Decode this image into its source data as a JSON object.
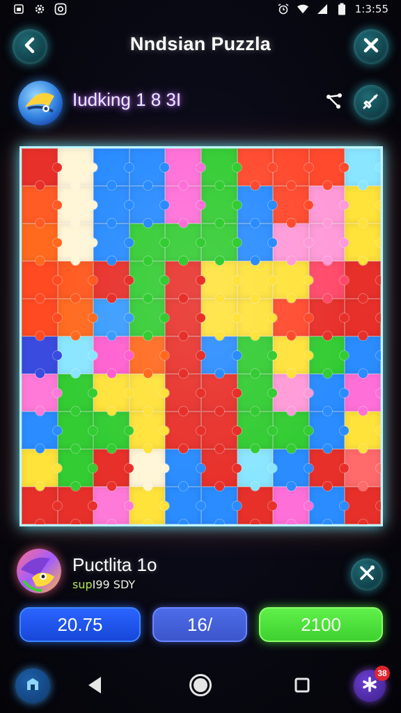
{
  "status_bar": {
    "time": "1:3:55",
    "left_icons": [
      "sim-icon",
      "settings-gear-icon",
      "at-icon"
    ],
    "right_icons": [
      "alarm-icon",
      "wifi-icon",
      "signal-icon",
      "battery-icon"
    ]
  },
  "header": {
    "title": "Nndsian Puzzla",
    "back_icon": "chevron-left-icon",
    "close_icon": "close-icon"
  },
  "player_top": {
    "name": "Iudking 1 8 3I",
    "share_icon": "share-icon",
    "hint_icon": "rocket-icon"
  },
  "board": {
    "rows": 10,
    "cols": 10,
    "pieces": [
      "#e8302a",
      "#fff6d8",
      "#2a8cff",
      "#2a8cff",
      "#ff6fd8",
      "#33cc33",
      "#ff4a2e",
      "#ff4a2e",
      "#ff4a2e",
      "#8ae6ff",
      "#ff5b25",
      "#fff6d8",
      "#2a8cff",
      "#2a8cff",
      "#ff6fd8",
      "#33cc33",
      "#2a8cff",
      "#ff4a2e",
      "#ff9ad8",
      "#ffe23a",
      "#ff6a1f",
      "#fff6d8",
      "#2a8cff",
      "#33cc33",
      "#33cc33",
      "#33cc33",
      "#2a8cff",
      "#ff9ad8",
      "#ff9ad8",
      "#ffe23a",
      "#ff4a22",
      "#ff5a20",
      "#e8302a",
      "#33cc33",
      "#e8302a",
      "#ffe23a",
      "#ffe23a",
      "#ffe23a",
      "#ff4a6a",
      "#e8302a",
      "#ff4a22",
      "#ff6a1f",
      "#3a9cff",
      "#33cc33",
      "#e8302a",
      "#ffe23a",
      "#ffe23a",
      "#ff4a2e",
      "#e8302a",
      "#e8302a",
      "#3a4be0",
      "#8ae6ff",
      "#ff5fcf",
      "#ff6a1f",
      "#e8302a",
      "#2a8cff",
      "#33cc33",
      "#ffe23a",
      "#33cc33",
      "#2a8cff",
      "#ff7ad8",
      "#33cc33",
      "#ffe23a",
      "#ffe23a",
      "#e8302a",
      "#e8302a",
      "#33cc33",
      "#ff9ad8",
      "#2a8cff",
      "#ff6fd8",
      "#2a8cff",
      "#33cc33",
      "#33cc33",
      "#ffe23a",
      "#e8302a",
      "#e8302a",
      "#33cc33",
      "#33cc33",
      "#2a8cff",
      "#ffe23a",
      "#ffe23a",
      "#33cc33",
      "#e8302a",
      "#fff6d8",
      "#2a8cff",
      "#e8302a",
      "#8ae6ff",
      "#2a8cff",
      "#e8302a",
      "#ff6a6a",
      "#e8302a",
      "#e8302a",
      "#ff7ad8",
      "#ffe23a",
      "#2a8cff",
      "#2a8cff",
      "#e8302a",
      "#ff6fd8",
      "#2a8cff",
      "#e8302a"
    ]
  },
  "player_bottom": {
    "name": "Puctlita 1o",
    "sub_accent": "sup",
    "sub_rest": "I99 SDY",
    "tool_icon": "tools-icon"
  },
  "stats": {
    "left": "20.75",
    "middle": "16/",
    "right": "2100"
  },
  "bottom_nav": {
    "home_icon": "home-icon",
    "back_icon": "triangle-back-icon",
    "home_circle_icon": "circle-home-icon",
    "recents_icon": "square-recents-icon",
    "notifications_icon": "notifications-icon",
    "badge_count": "38"
  },
  "colors": {
    "accent_teal": "#2fc7d3",
    "stat_blue": "#2a64ff",
    "stat_slate": "#4d6ce8",
    "stat_green": "#4fe63a",
    "name_glow": "#b06cff"
  }
}
